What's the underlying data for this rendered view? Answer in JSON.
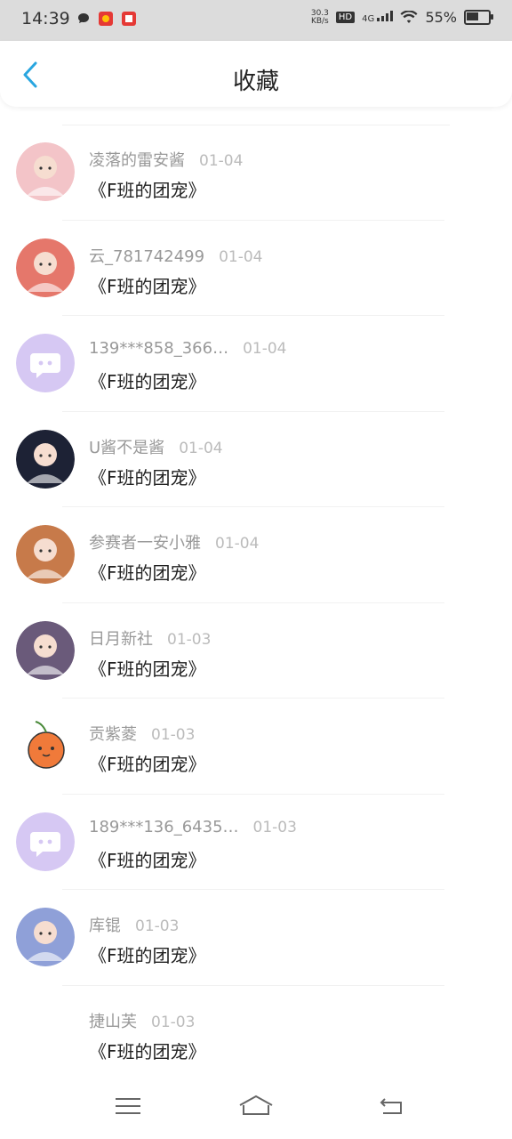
{
  "status": {
    "time": "14:39",
    "speed_top": "30.3",
    "speed_unit": "KB/s",
    "hd": "HD",
    "network": "4G",
    "battery": "55%",
    "battery_level": 0.55
  },
  "header": {
    "title": "收藏"
  },
  "items": [
    {
      "name": "凌落的雷安酱",
      "date": "01-04",
      "work": "《F班的团宠》",
      "avatar": "anime-pink",
      "color": "#f3c4c8"
    },
    {
      "name": "云_781742499",
      "date": "01-04",
      "work": "《F班的团宠》",
      "avatar": "anime-red-hair",
      "color": "#e5776b"
    },
    {
      "name": "139***858_366…",
      "date": "01-04",
      "work": "《F班的团宠》",
      "avatar": "default-chat",
      "color": "#d6c8f3"
    },
    {
      "name": "U酱不是酱",
      "date": "01-04",
      "work": "《F班的团宠》",
      "avatar": "anime-dark",
      "color": "#1d2235"
    },
    {
      "name": "参赛者一安小雅",
      "date": "01-04",
      "work": "《F班的团宠》",
      "avatar": "anime-fox",
      "color": "#c77a4a"
    },
    {
      "name": "日月新社",
      "date": "01-03",
      "work": "《F班的团宠》",
      "avatar": "anime-white-hair",
      "color": "#6a5a7a"
    },
    {
      "name": "贡紫菱",
      "date": "01-03",
      "work": "《F班的团宠》",
      "avatar": "orange-fruit",
      "color": "#f07a3a"
    },
    {
      "name": "189***136_6435…",
      "date": "01-03",
      "work": "《F班的团宠》",
      "avatar": "default-chat",
      "color": "#d6c8f3"
    },
    {
      "name": "库锟",
      "date": "01-03",
      "work": "《F班的团宠》",
      "avatar": "girl-cartoon",
      "color": "#8fa0d8"
    },
    {
      "name": "捷山芙",
      "date": "01-03",
      "work": "《F班的团宠》",
      "avatar": "none",
      "color": "#ffffff"
    }
  ]
}
